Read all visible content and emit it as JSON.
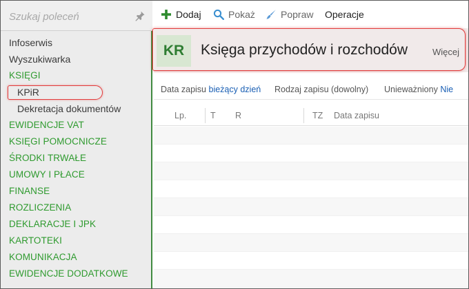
{
  "sidebar": {
    "search_placeholder": "Szukaj poleceń",
    "items": [
      {
        "label": "Infoserwis",
        "kind": "plain"
      },
      {
        "label": "Wyszukiwarka",
        "kind": "plain"
      },
      {
        "label": "KSIĘGI",
        "kind": "group"
      },
      {
        "label": "KPiR",
        "kind": "sub",
        "selected": true
      },
      {
        "label": "Dekretacja dokumentów",
        "kind": "sub"
      },
      {
        "label": "EWIDENCJE VAT",
        "kind": "group"
      },
      {
        "label": "KSIĘGI POMOCNICZE",
        "kind": "group"
      },
      {
        "label": "ŚRODKI TRWAŁE",
        "kind": "group"
      },
      {
        "label": "UMOWY I PŁACE",
        "kind": "group"
      },
      {
        "label": "FINANSE",
        "kind": "group"
      },
      {
        "label": "ROZLICZENIA",
        "kind": "group"
      },
      {
        "label": "DEKLARACJE I JPK",
        "kind": "group"
      },
      {
        "label": "KARTOTEKI",
        "kind": "group"
      },
      {
        "label": "KOMUNIKACJA",
        "kind": "group"
      },
      {
        "label": "EWIDENCJE DODATKOWE",
        "kind": "group"
      }
    ]
  },
  "toolbar": {
    "add_label": "Dodaj",
    "show_label": "Pokaż",
    "edit_label": "Popraw",
    "operations_label": "Operacje"
  },
  "header": {
    "badge": "KR",
    "title": "Księga przychodów i rozchodów",
    "more_label": "Więcej"
  },
  "filters": {
    "date_label": "Data zapisu",
    "date_value": "bieżący dzień",
    "type_label": "Rodzaj zapisu (dowolny)",
    "void_label": "Unieważniony",
    "void_value": "Nie"
  },
  "table": {
    "columns": [
      "Lp.",
      "T",
      "R",
      "TZ",
      "Data zapisu"
    ],
    "row_count": 9
  },
  "colors": {
    "accent_green": "#2e9a2e",
    "highlight_red": "#e23a3a",
    "link_blue": "#1a5fb4",
    "badge_bg": "#d8e7d2",
    "header_bg": "#f1eaea"
  },
  "icons": {
    "pin": "pin-icon",
    "add": "plus-icon",
    "show": "magnifier-icon",
    "edit": "brush-icon"
  }
}
